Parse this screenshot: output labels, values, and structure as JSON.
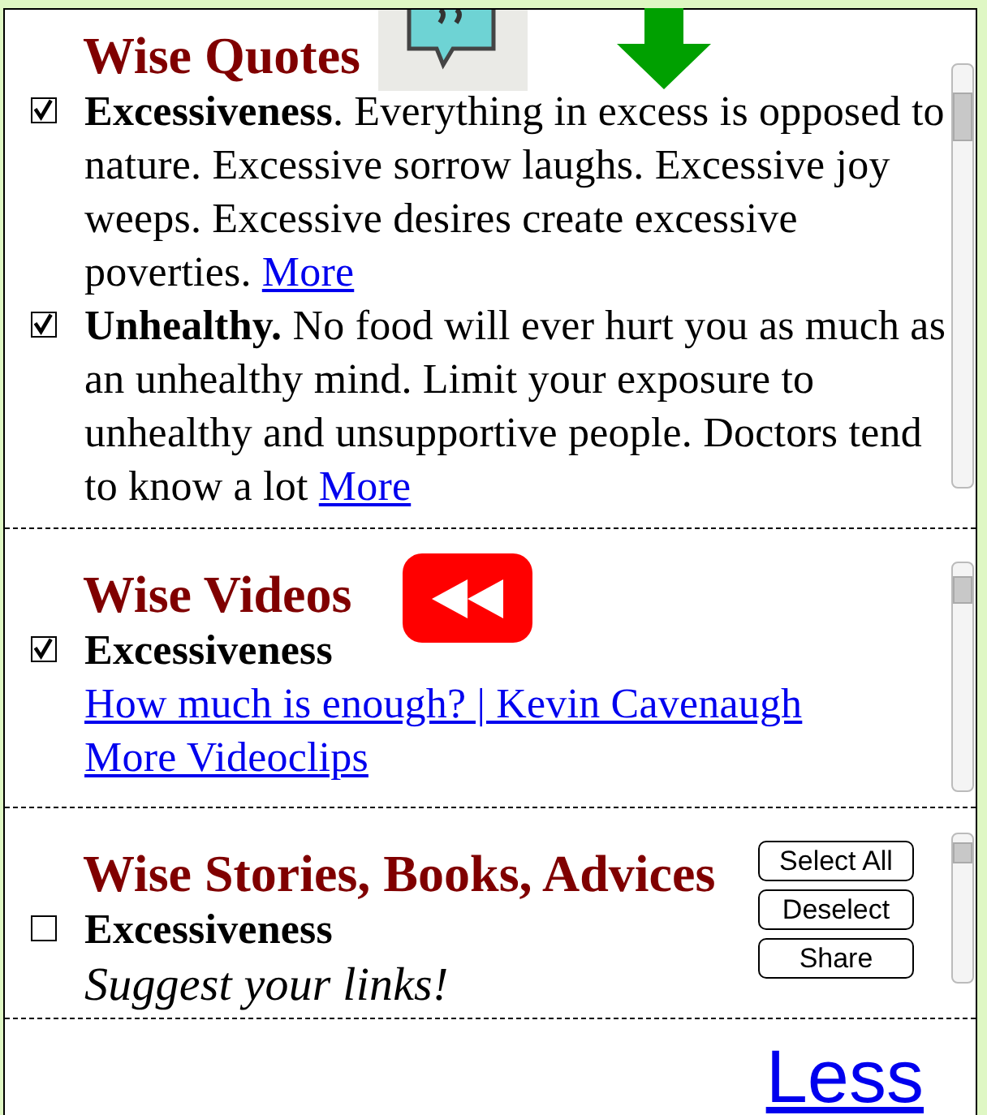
{
  "sections": [
    {
      "kind": "quotes",
      "title": "Wise Quotes",
      "items": [
        {
          "checked": true,
          "text": "**Excessiveness**. Everything in excess is opposed to nature. Excessive sorrow laughs. Excessive joy weeps. Excessive desires create excessive poverties.",
          "link": "More"
        },
        {
          "checked": true,
          "text": "**Unhealthy.** No food will ever hurt you as much as an unhealthy mind. Limit your exposure to unhealthy and unsupportive people. Doctors tend to know a lot",
          "link": "More"
        }
      ]
    },
    {
      "kind": "videos",
      "title": "Wise Videos",
      "items": [
        {
          "checked": true,
          "heading": "Excessiveness",
          "links": [
            "How much is enough? | Kevin Cavenaugh",
            "More Videoclips"
          ]
        }
      ]
    },
    {
      "title": "Wise Stories, Books, Advices",
      "buttons": [
        "Select All",
        "Deselect",
        "Share"
      ],
      "items": [
        {
          "checked": false,
          "heading": "Excessiveness",
          "note": "Suggest your links!"
        }
      ]
    }
  ],
  "footer_link": "Less"
}
